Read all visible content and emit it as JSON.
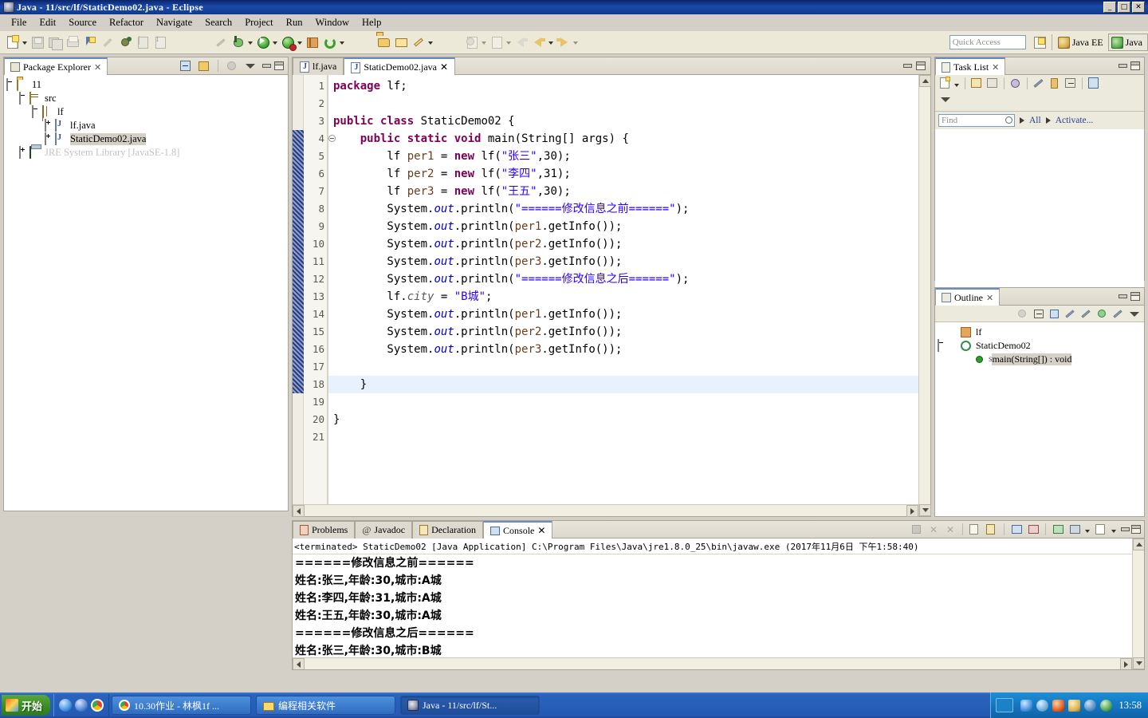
{
  "window": {
    "title": "Java - 11/src/lf/StaticDemo02.java - Eclipse",
    "icon": "eclipse-icon",
    "minimize": "_",
    "maximize": "□",
    "close": "✕"
  },
  "menubar": {
    "items": [
      {
        "label": "File"
      },
      {
        "label": "Edit"
      },
      {
        "label": "Source"
      },
      {
        "label": "Refactor"
      },
      {
        "label": "Navigate"
      },
      {
        "label": "Search"
      },
      {
        "label": "Project"
      },
      {
        "label": "Run"
      },
      {
        "label": "Window"
      },
      {
        "label": "Help"
      }
    ]
  },
  "toolbar": {
    "quick_access_placeholder": "Quick Access",
    "perspectives": [
      {
        "label": "Java EE",
        "icon": "java-ee-perspective-icon",
        "active": false
      },
      {
        "label": "Java",
        "icon": "java-perspective-icon",
        "active": true
      }
    ],
    "open_perspective_icon": "open-perspective-icon",
    "icons": [
      "new-wizard-icon",
      "save-icon",
      "save-all-icon",
      "print-icon",
      "new-java-package-icon",
      "quick-fix-icon",
      "debug-icon",
      "open-type-icon",
      "open-task-icon",
      "skip-breakpoints-icon",
      "debug-run-icon",
      "run-icon",
      "run-error-icon",
      "new-package-gift-icon",
      "external-tools-icon",
      "open-folder-icon",
      "open-resource-icon",
      "annotate-icon",
      "next-annotation-icon",
      "previous-annotation-icon",
      "back-icon",
      "forward-icon"
    ]
  },
  "package_explorer": {
    "tab_label": "Package Explorer",
    "tab_icon": "package-explorer-icon",
    "close_icon": "✕",
    "toolbar_icons": [
      "collapse-all-icon",
      "link-with-editor-icon",
      "focus-icon",
      "view-menu-icon"
    ],
    "minimize_icon": "minimize-icon",
    "maximize_icon": "maximize-icon",
    "tree": [
      {
        "label": "11",
        "icon": "project-icon",
        "depth": 0,
        "twisty": "minus",
        "selected": false,
        "dim": false
      },
      {
        "label": "src",
        "icon": "source-folder-icon",
        "depth": 1,
        "twisty": "minus",
        "selected": false,
        "dim": false
      },
      {
        "label": "lf",
        "icon": "package-icon",
        "depth": 2,
        "twisty": "minus",
        "selected": false,
        "dim": false
      },
      {
        "label": "lf.java",
        "icon": "java-file-icon",
        "depth": 3,
        "twisty": "plus",
        "selected": false,
        "dim": false
      },
      {
        "label": "StaticDemo02.java",
        "icon": "java-file-icon",
        "depth": 3,
        "twisty": "plus",
        "selected": true,
        "dim": false
      },
      {
        "label": "JRE System Library  [JavaSE-1.8]",
        "icon": "jre-library-icon",
        "depth": 1,
        "twisty": "plus",
        "selected": false,
        "dim": true
      }
    ]
  },
  "editor": {
    "tabs": [
      {
        "label": "lf.java",
        "icon": "java-file-icon",
        "active": false,
        "closeable": false
      },
      {
        "label": "StaticDemo02.java",
        "icon": "java-file-icon",
        "active": true,
        "closeable": true,
        "close_icon": "✕"
      }
    ],
    "minimize_icon": "minimize-icon",
    "maximize_icon": "maximize-icon",
    "current_line": 18,
    "change_bar_from": 4,
    "change_bar_to": 18,
    "fold_line": 4,
    "lines": [
      {
        "n": 1,
        "tokens": [
          {
            "t": "kw",
            "v": "package"
          },
          {
            "t": "plain",
            "v": " "
          },
          {
            "t": "plain",
            "v": "lf;"
          }
        ]
      },
      {
        "n": 2,
        "tokens": []
      },
      {
        "n": 3,
        "tokens": [
          {
            "t": "kw",
            "v": "public class"
          },
          {
            "t": "plain",
            "v": " StaticDemo02 {"
          }
        ]
      },
      {
        "n": 4,
        "tokens": [
          {
            "t": "plain",
            "v": "    "
          },
          {
            "t": "kw",
            "v": "public static void"
          },
          {
            "t": "plain",
            "v": " main(String[] args) {"
          }
        ]
      },
      {
        "n": 5,
        "tokens": [
          {
            "t": "plain",
            "v": "        lf "
          },
          {
            "t": "loc",
            "v": "per1"
          },
          {
            "t": "plain",
            "v": " = "
          },
          {
            "t": "kw",
            "v": "new"
          },
          {
            "t": "plain",
            "v": " lf("
          },
          {
            "t": "str",
            "v": "\"张三\""
          },
          {
            "t": "plain",
            "v": ",30);"
          }
        ]
      },
      {
        "n": 6,
        "tokens": [
          {
            "t": "plain",
            "v": "        lf "
          },
          {
            "t": "loc",
            "v": "per2"
          },
          {
            "t": "plain",
            "v": " = "
          },
          {
            "t": "kw",
            "v": "new"
          },
          {
            "t": "plain",
            "v": " lf("
          },
          {
            "t": "str",
            "v": "\"李四\""
          },
          {
            "t": "plain",
            "v": ",31);"
          }
        ]
      },
      {
        "n": 7,
        "tokens": [
          {
            "t": "plain",
            "v": "        lf "
          },
          {
            "t": "loc",
            "v": "per3"
          },
          {
            "t": "plain",
            "v": " = "
          },
          {
            "t": "kw",
            "v": "new"
          },
          {
            "t": "plain",
            "v": " lf("
          },
          {
            "t": "str",
            "v": "\"王五\""
          },
          {
            "t": "plain",
            "v": ",30);"
          }
        ]
      },
      {
        "n": 8,
        "tokens": [
          {
            "t": "plain",
            "v": "        System."
          },
          {
            "t": "fld",
            "v": "out"
          },
          {
            "t": "plain",
            "v": ".println("
          },
          {
            "t": "str",
            "v": "\"======修改信息之前======\""
          },
          {
            "t": "plain",
            "v": ");"
          }
        ]
      },
      {
        "n": 9,
        "tokens": [
          {
            "t": "plain",
            "v": "        System."
          },
          {
            "t": "fld",
            "v": "out"
          },
          {
            "t": "plain",
            "v": ".println("
          },
          {
            "t": "loc",
            "v": "per1"
          },
          {
            "t": "plain",
            "v": ".getInfo());"
          }
        ]
      },
      {
        "n": 10,
        "tokens": [
          {
            "t": "plain",
            "v": "        System."
          },
          {
            "t": "fld",
            "v": "out"
          },
          {
            "t": "plain",
            "v": ".println("
          },
          {
            "t": "loc",
            "v": "per2"
          },
          {
            "t": "plain",
            "v": ".getInfo());"
          }
        ]
      },
      {
        "n": 11,
        "tokens": [
          {
            "t": "plain",
            "v": "        System."
          },
          {
            "t": "fld",
            "v": "out"
          },
          {
            "t": "plain",
            "v": ".println("
          },
          {
            "t": "loc",
            "v": "per3"
          },
          {
            "t": "plain",
            "v": ".getInfo());"
          }
        ]
      },
      {
        "n": 12,
        "tokens": [
          {
            "t": "plain",
            "v": "        System."
          },
          {
            "t": "fld",
            "v": "out"
          },
          {
            "t": "plain",
            "v": ".println("
          },
          {
            "t": "str",
            "v": "\"======修改信息之后======\""
          },
          {
            "t": "plain",
            "v": ");"
          }
        ]
      },
      {
        "n": 13,
        "tokens": [
          {
            "t": "plain",
            "v": "        lf."
          },
          {
            "t": "sfld",
            "v": "city"
          },
          {
            "t": "plain",
            "v": " = "
          },
          {
            "t": "str",
            "v": "\"B城\""
          },
          {
            "t": "plain",
            "v": ";"
          }
        ]
      },
      {
        "n": 14,
        "tokens": [
          {
            "t": "plain",
            "v": "        System."
          },
          {
            "t": "fld",
            "v": "out"
          },
          {
            "t": "plain",
            "v": ".println("
          },
          {
            "t": "loc",
            "v": "per1"
          },
          {
            "t": "plain",
            "v": ".getInfo());"
          }
        ]
      },
      {
        "n": 15,
        "tokens": [
          {
            "t": "plain",
            "v": "        System."
          },
          {
            "t": "fld",
            "v": "out"
          },
          {
            "t": "plain",
            "v": ".println("
          },
          {
            "t": "loc",
            "v": "per2"
          },
          {
            "t": "plain",
            "v": ".getInfo());"
          }
        ]
      },
      {
        "n": 16,
        "tokens": [
          {
            "t": "plain",
            "v": "        System."
          },
          {
            "t": "fld",
            "v": "out"
          },
          {
            "t": "plain",
            "v": ".println("
          },
          {
            "t": "loc",
            "v": "per3"
          },
          {
            "t": "plain",
            "v": ".getInfo());"
          }
        ]
      },
      {
        "n": 17,
        "tokens": []
      },
      {
        "n": 18,
        "tokens": [
          {
            "t": "plain",
            "v": "    }"
          }
        ]
      },
      {
        "n": 19,
        "tokens": []
      },
      {
        "n": 20,
        "tokens": [
          {
            "t": "plain",
            "v": "}"
          }
        ]
      },
      {
        "n": 21,
        "tokens": []
      }
    ]
  },
  "task_list": {
    "tab_label": "Task List",
    "tab_icon": "task-list-icon",
    "close_icon": "✕",
    "toolbar_icons": [
      "new-task-icon",
      "categorized-presentation-icon",
      "scheduled-presentation-icon",
      "focus-on-workweek-icon",
      "synchronize-changed-icon",
      "restore-tasks-icon",
      "collapse-all-icon",
      "open-repository-task-icon",
      "view-menu-icon"
    ],
    "find_placeholder": "Find",
    "find_icon": "search-icon",
    "filter_all": "All",
    "filter_activate": "Activate...",
    "minimize_icon": "minimize-icon",
    "maximize_icon": "maximize-icon"
  },
  "outline": {
    "tab_label": "Outline",
    "tab_icon": "outline-icon",
    "close_icon": "✕",
    "toolbar_icons": [
      "focus-icon",
      "collapse-all-icon",
      "sort-icon",
      "hide-fields-icon",
      "hide-static-icon",
      "hide-nonpublic-icon",
      "hide-local-types-icon",
      "view-menu-icon"
    ],
    "minimize_icon": "minimize-icon",
    "maximize_icon": "maximize-icon",
    "tree": [
      {
        "label": "lf",
        "icon": "package-declaration-icon",
        "depth": 1,
        "twisty": "none",
        "selected": false,
        "modifier": ""
      },
      {
        "label": "StaticDemo02",
        "icon": "class-icon",
        "depth": 1,
        "twisty": "minus",
        "selected": false,
        "modifier": ""
      },
      {
        "label": "main(String[]) : void",
        "icon": "public-method-icon",
        "depth": 2,
        "twisty": "none",
        "selected": true,
        "modifier": "S"
      }
    ]
  },
  "console": {
    "tabs": [
      {
        "label": "Problems",
        "icon": "problems-icon",
        "active": false
      },
      {
        "label": "Javadoc",
        "icon": "javadoc-icon",
        "active": false
      },
      {
        "label": "Declaration",
        "icon": "declaration-icon",
        "active": false
      },
      {
        "label": "Console",
        "icon": "console-icon",
        "active": true,
        "close_icon": "✕"
      }
    ],
    "toolbar_icons": [
      "terminate-icon",
      "remove-launch-icon",
      "remove-all-launches-icon",
      "clear-console-icon",
      "scroll-lock-icon",
      "pin-console-icon",
      "display-selected-console-icon",
      "open-console-icon",
      "new-console-view-icon",
      "console-menu-icon"
    ],
    "minimize_icon": "minimize-icon",
    "maximize_icon": "maximize-icon",
    "header": "<terminated> StaticDemo02 [Java Application] C:\\Program Files\\Java\\jre1.8.0_25\\bin\\javaw.exe (2017年11月6日 下午1:58:40)",
    "output": [
      "======修改信息之前======",
      "姓名:张三,年龄:30,城市:A城",
      "姓名:李四,年龄:31,城市:A城",
      "姓名:王五,年龄:30,城市:A城",
      "======修改信息之后======",
      "姓名:张三,年龄:30,城市:B城"
    ]
  },
  "taskbar": {
    "start_label": "开始",
    "start_icon": "windows-start-icon",
    "quick_launch": [
      {
        "icon": "internet-explorer-icon"
      },
      {
        "icon": "browser-icon"
      },
      {
        "icon": "chrome-icon"
      }
    ],
    "tasks": [
      {
        "label": "10.30作业 - 林枫1f ...",
        "icon": "chrome-icon",
        "active": false
      },
      {
        "label": "编程相关软件",
        "icon": "folder-icon",
        "active": false
      },
      {
        "label": "Java - 11/src/lf/St...",
        "icon": "eclipse-icon",
        "active": true
      }
    ],
    "tray": {
      "language_icon": "input-method-icon",
      "icons": [
        "network-icon",
        "security-icon",
        "volume-icon",
        "update-icon",
        "sound-icon",
        "antivirus-icon"
      ],
      "clock": "13:58"
    }
  },
  "colors": {
    "title_bar": "#0a246a",
    "keyword": "#7f0055",
    "string": "#2a00ff",
    "field": "#0000c0",
    "local_var": "#6a3e1e",
    "current_line": "#e8f2fe",
    "chrome": "#d4d0c8",
    "taskbar": "#2a63bd"
  }
}
